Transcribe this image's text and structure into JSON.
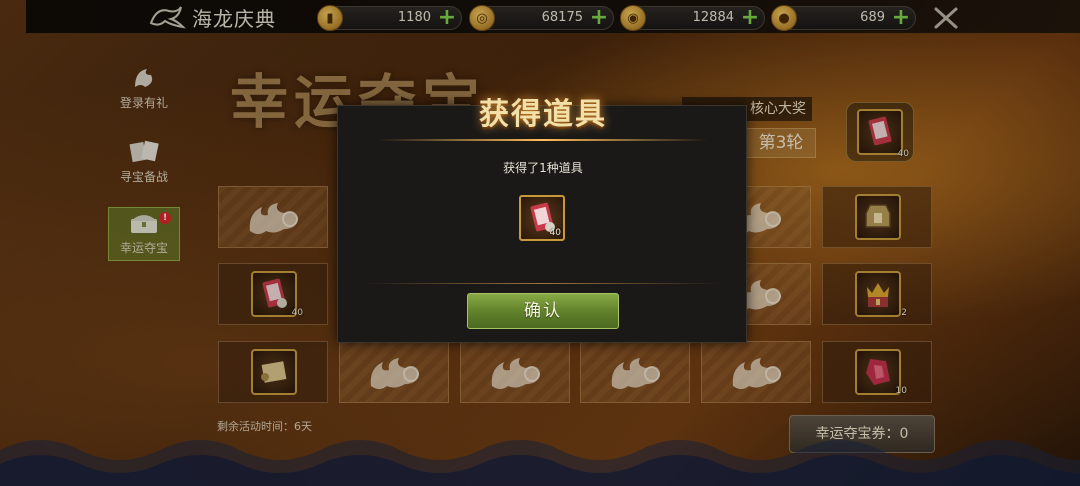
{
  "header": {
    "title": "海龙庆典",
    "currencies": [
      {
        "icon": "card-currency-icon",
        "value": "1180"
      },
      {
        "icon": "swirl-coin-icon",
        "value": "68175"
      },
      {
        "icon": "gold-ingot-icon",
        "value": "12884"
      },
      {
        "icon": "gold-coin-icon",
        "value": "689"
      }
    ]
  },
  "sidebar": {
    "items": [
      {
        "label": "登录有礼",
        "icon": "dragon-emblem-icon",
        "active": false
      },
      {
        "label": "寻宝备战",
        "icon": "cards-icon",
        "active": false
      },
      {
        "label": "幸运夺宝",
        "icon": "treasure-chest-icon",
        "active": true,
        "badge": "!"
      }
    ]
  },
  "banner": {
    "title": "幸运夺宝",
    "prize_label": "核心大奖",
    "round_label": "第3轮",
    "prize_count": "40"
  },
  "grid": {
    "cells": [
      {
        "type": "hidden"
      },
      {
        "type": "hidden"
      },
      {
        "type": "hidden"
      },
      {
        "type": "hidden"
      },
      {
        "type": "hidden"
      },
      {
        "type": "item",
        "icon": "lantern-icon",
        "count": ""
      },
      {
        "type": "item",
        "icon": "skill-card-icon",
        "count": "40"
      },
      {
        "type": "hidden"
      },
      {
        "type": "hidden"
      },
      {
        "type": "hidden"
      },
      {
        "type": "hidden"
      },
      {
        "type": "item",
        "icon": "crown-chest-icon",
        "count": "2"
      },
      {
        "type": "item",
        "icon": "scroll-icon",
        "count": ""
      },
      {
        "type": "hidden"
      },
      {
        "type": "hidden"
      },
      {
        "type": "hidden"
      },
      {
        "type": "hidden"
      },
      {
        "type": "item",
        "icon": "gem-box-icon",
        "count": "10"
      }
    ]
  },
  "footer": {
    "remaining_time": "剩余活动时间：6天",
    "ticket_label": "幸运夺宝券：0"
  },
  "modal": {
    "title": "获得道具",
    "message": "获得了1种道具",
    "item_icon": "skill-card-icon",
    "item_count": "40",
    "confirm_label": "确认"
  },
  "colors": {
    "accent_green": "#7fb33a",
    "gold": "#c69a3c",
    "title_glow": "#f3dfa8"
  }
}
